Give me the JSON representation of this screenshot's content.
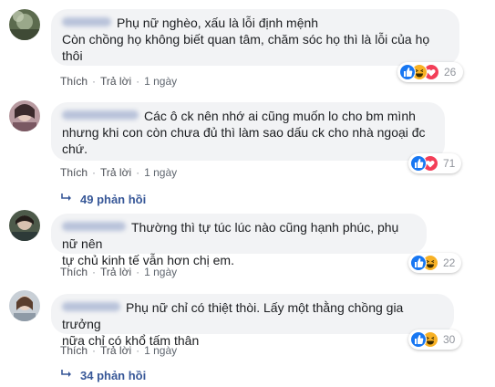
{
  "comments": [
    {
      "text_lines": [
        "Phụ nữ nghèo, xấu là lỗi định mệnh",
        "Còn chồng họ không biết quan tâm, chăm sóc họ thì là lỗi của họ",
        "thôi"
      ],
      "actions": {
        "like": "Thích",
        "reply": "Trả lời",
        "time": "1 ngày"
      },
      "reaction_count": "26",
      "reactions": [
        "like-icon",
        "haha-icon",
        "love-icon"
      ]
    },
    {
      "text_lines": [
        "Các ô ck nên nhớ ai cũng muốn lo cho bm mình",
        "nhưng khi con còn chưa đủ thì làm sao dấu ck cho nhà ngoại đc",
        "chứ."
      ],
      "actions": {
        "like": "Thích",
        "reply": "Trả lời",
        "time": "1 ngày"
      },
      "reaction_count": "71",
      "reactions": [
        "like-icon",
        "love-icon"
      ],
      "replies": "49 phản hồi"
    },
    {
      "text_lines": [
        "Thường thì tự túc lúc nào cũng hạnh phúc, phụ nữ nên",
        "tự chủ kinh tế vẫn hơn chị em."
      ],
      "actions": {
        "like": "Thích",
        "reply": "Trả lời",
        "time": "1 ngày"
      },
      "reaction_count": "22",
      "reactions": [
        "like-icon",
        "haha-icon"
      ]
    },
    {
      "text_lines": [
        "Phụ nữ chỉ có thiệt thòi. Lấy một thằng chồng gia trưởng",
        "nữa chỉ có khổ tấm thân"
      ],
      "actions": {
        "like": "Thích",
        "reply": "Trả lời",
        "time": "1 ngày"
      },
      "reaction_count": "30",
      "reactions": [
        "like-icon",
        "haha-icon"
      ],
      "replies": "34 phản hồi"
    }
  ],
  "colors": {
    "like": "#1877f2",
    "love": "#f33e58",
    "haha": "#f7b125",
    "bubble": "#f2f3f5",
    "link": "#385898"
  }
}
